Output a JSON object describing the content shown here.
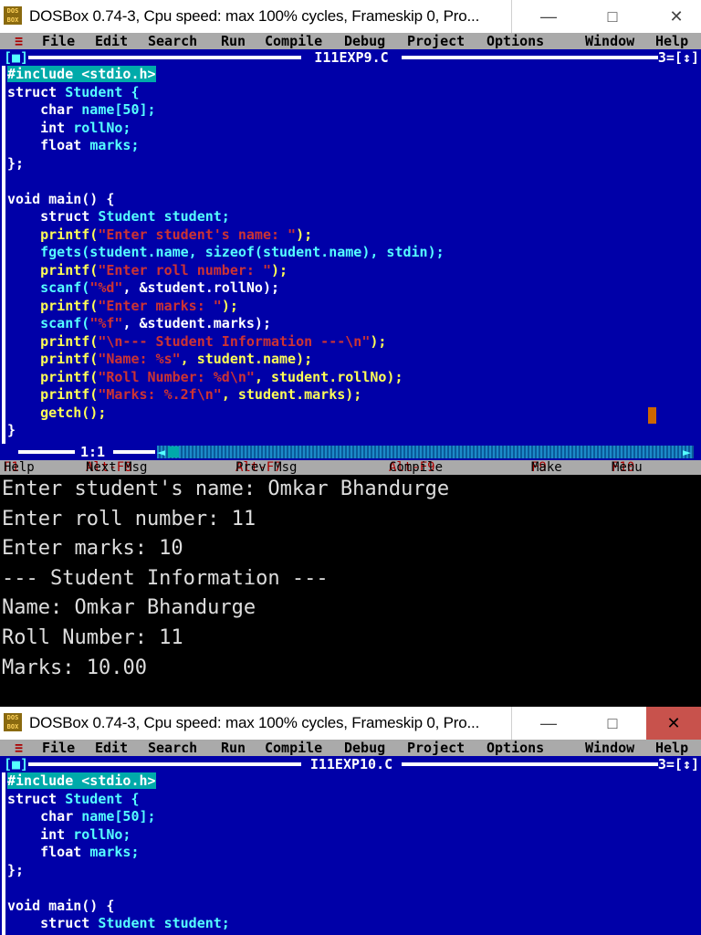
{
  "window1": {
    "title": "DOSBox 0.74-3, Cpu speed: max 100% cycles, Frameskip  0, Pro...",
    "icon_text": "DOS BOX",
    "minimize_glyph": "—",
    "maximize_glyph": "□",
    "close_glyph": "✕",
    "editor": {
      "filename": "I11EXP9.C",
      "left_box": "[■]",
      "right_box": "3=[↕]",
      "cursor_position": "1:1",
      "code": {
        "l1": "#include <stdio.h>",
        "l2a": "struct ",
        "l2b": "Student {",
        "l3a": "    char ",
        "l3b": "name[50];",
        "l4a": "    int ",
        "l4b": "rollNo;",
        "l5a": "    float ",
        "l5b": "marks;",
        "l6": "};",
        "l8a": "void ",
        "l8b": "main() {",
        "l9a": "    struct ",
        "l9b": "Student student;",
        "l10a": "    printf(",
        "l10b": "\"Enter student's name: \"",
        "l10c": ");",
        "l11": "    fgets(student.name, sizeof(student.name), stdin);",
        "l12a": "    printf(",
        "l12b": "\"Enter roll number: \"",
        "l12c": ");",
        "l13a": "    scanf(",
        "l13b": "\"%d\"",
        "l13c": ", &student.rollNo);",
        "l14a": "    printf(",
        "l14b": "\"Enter marks: \"",
        "l14c": ");",
        "l15a": "    scanf(",
        "l15b": "\"%f\"",
        "l15c": ", &student.marks);",
        "l16a": "    printf(",
        "l16b": "\"\\n--- Student Information ---\\n\"",
        "l16c": ");",
        "l17a": "    printf(",
        "l17b": "\"Name: %s\"",
        "l17c": ", student.name);",
        "l18a": "    printf(",
        "l18b": "\"Roll Number: %d\\n\"",
        "l18c": ", student.rollNo);",
        "l19a": "    printf(",
        "l19b": "\"Marks: %.2f\\n\"",
        "l19c": ", student.marks);",
        "l20": "    getch();",
        "l21": "}"
      }
    },
    "function_keys": [
      {
        "key": "F1",
        "label": "Help"
      },
      {
        "key": "Alt-F8",
        "label": "Next Msg"
      },
      {
        "key": "Alt-F7",
        "label": "Prev Msg"
      },
      {
        "key": "Alt-F9",
        "label": "Compile"
      },
      {
        "key": "F9",
        "label": "Make"
      },
      {
        "key": "F10",
        "label": "Menu"
      }
    ]
  },
  "menu": {
    "system": "≡",
    "file": "File",
    "edit": "Edit",
    "search": "Search",
    "run": "Run",
    "compile": "Compile",
    "debug": "Debug",
    "project": "Project",
    "options": "Options",
    "window": "Window",
    "help": "Help"
  },
  "output": {
    "lines": [
      "Enter student's name: Omkar Bhandurge",
      "Enter roll number: 11",
      "Enter marks: 10",
      "",
      "--- Student Information ---",
      "Name: Omkar Bhandurge",
      "Roll Number: 11",
      "Marks: 10.00"
    ]
  },
  "window2": {
    "title": "DOSBox 0.74-3, Cpu speed: max 100% cycles, Frameskip  0, Pro...",
    "icon_text": "DOS BOX",
    "minimize_glyph": "—",
    "maximize_glyph": "□",
    "close_glyph": "✕",
    "editor": {
      "filename": "I11EXP10.C",
      "left_box": "[■]",
      "right_box": "3=[↕]",
      "code": {
        "l1": "#include <stdio.h>",
        "l2a": "struct ",
        "l2b": "Student {",
        "l3a": "    char ",
        "l3b": "name[50];",
        "l4a": "    int ",
        "l4b": "rollNo;",
        "l5a": "    float ",
        "l5b": "marks;",
        "l6": "};",
        "l8a": "void ",
        "l8b": "main() {",
        "l9a": "    struct ",
        "l9b": "Student student;"
      }
    }
  }
}
